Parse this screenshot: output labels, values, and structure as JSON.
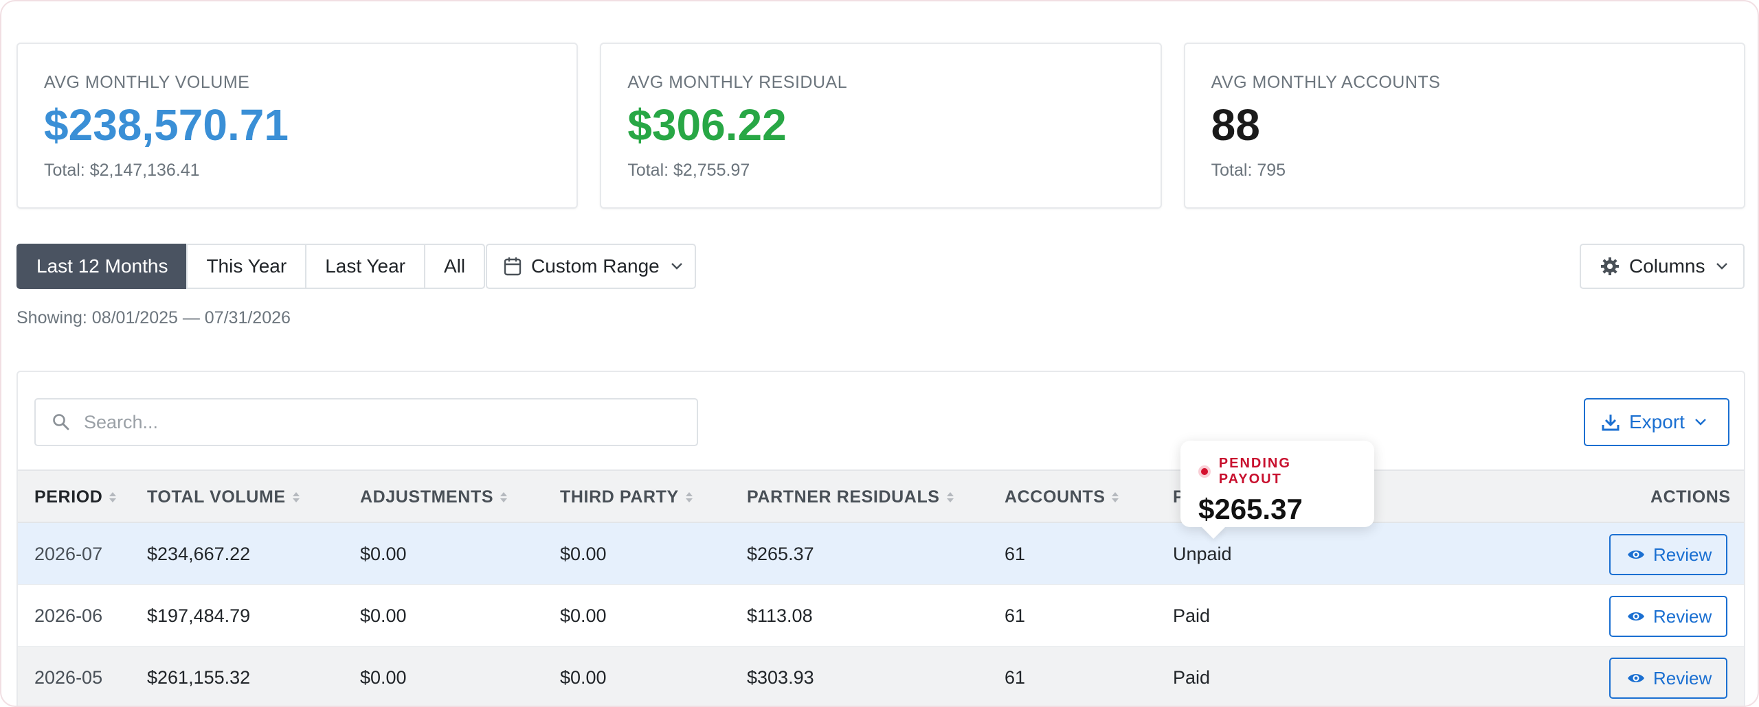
{
  "stats": [
    {
      "label": "AVG MONTHLY VOLUME",
      "value": "$238,570.71",
      "total": "Total: $2,147,136.41",
      "color": "#3a8fd6"
    },
    {
      "label": "AVG MONTHLY RESIDUAL",
      "value": "$306.22",
      "total": "Total: $2,755.97",
      "color": "#28a745"
    },
    {
      "label": "AVG MONTHLY ACCOUNTS",
      "value": "88",
      "total": "Total: 795",
      "color": "#1a1a1a"
    }
  ],
  "filters": {
    "range_buttons": [
      "Last 12 Months",
      "This Year",
      "Last Year",
      "All"
    ],
    "active_range": "Last 12 Months",
    "custom_range_label": "Custom Range",
    "columns_label": "Columns"
  },
  "showing": "Showing: 08/01/2025 — 07/31/2026",
  "table": {
    "search_placeholder": "Search...",
    "export_label": "Export",
    "columns": [
      "PERIOD",
      "TOTAL VOLUME",
      "ADJUSTMENTS",
      "THIRD PARTY",
      "PARTNER RESIDUALS",
      "ACCOUNTS",
      "P",
      "ACTIONS"
    ],
    "rows": [
      {
        "period": "2026-07",
        "total_volume": "$234,667.22",
        "adjustments": "$0.00",
        "third_party": "$0.00",
        "partner_residuals": "$265.37",
        "accounts": "61",
        "status": "Unpaid",
        "action": "Review"
      },
      {
        "period": "2026-06",
        "total_volume": "$197,484.79",
        "adjustments": "$0.00",
        "third_party": "$0.00",
        "partner_residuals": "$113.08",
        "accounts": "61",
        "status": "Paid",
        "action": "Review"
      },
      {
        "period": "2026-05",
        "total_volume": "$261,155.32",
        "adjustments": "$0.00",
        "third_party": "$0.00",
        "partner_residuals": "$303.93",
        "accounts": "61",
        "status": "Paid",
        "action": "Review"
      }
    ]
  },
  "tooltip": {
    "label": "PENDING PAYOUT",
    "value": "$265.37"
  },
  "colors": {
    "accent": "#1a6fd1",
    "active_button": "#4a5361",
    "highlight_row": "#e6f0fc",
    "tooltip_label": "#c8102e"
  }
}
